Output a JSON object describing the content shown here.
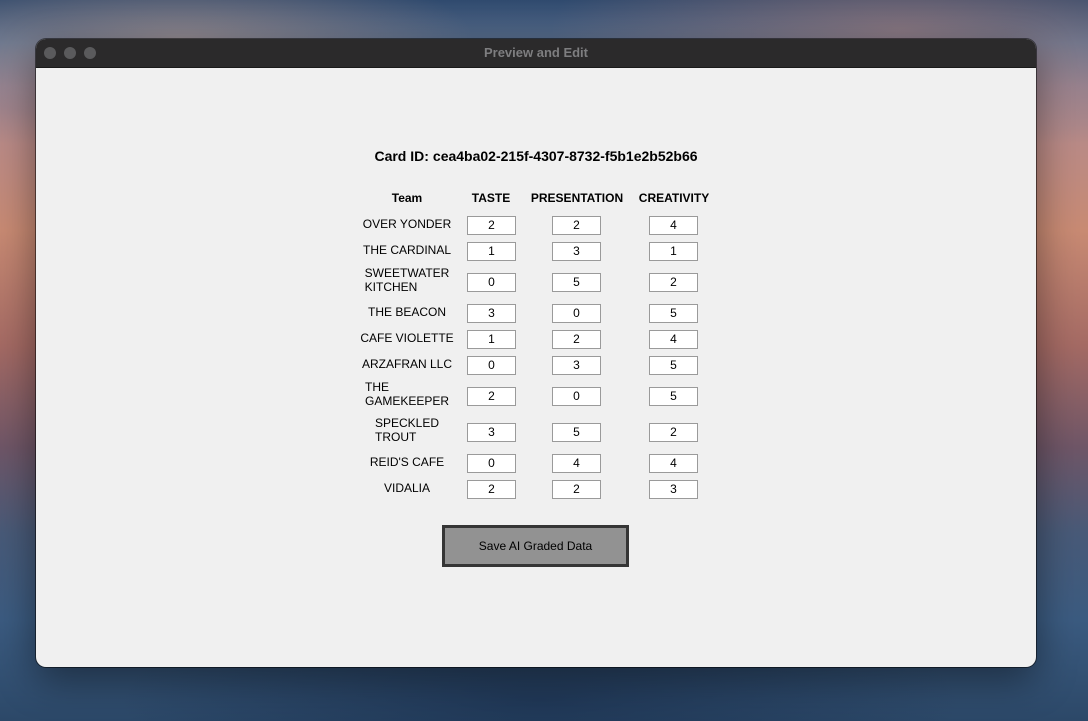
{
  "window": {
    "title": "Preview and Edit"
  },
  "card": {
    "label": "Card ID:",
    "id": "cea4ba02-215f-4307-8732-f5b1e2b52b66"
  },
  "columns": [
    "Team",
    "TASTE",
    "PRESENTATION",
    "CREATIVITY"
  ],
  "rows": [
    {
      "team": "OVER YONDER",
      "taste": "2",
      "presentation": "2",
      "creativity": "4"
    },
    {
      "team": "THE CARDINAL",
      "taste": "1",
      "presentation": "3",
      "creativity": "1"
    },
    {
      "team": "SWEETWATER\nKITCHEN",
      "taste": "0",
      "presentation": "5",
      "creativity": "2"
    },
    {
      "team": "THE BEACON",
      "taste": "3",
      "presentation": "0",
      "creativity": "5"
    },
    {
      "team": "CAFE VIOLETTE",
      "taste": "1",
      "presentation": "2",
      "creativity": "4"
    },
    {
      "team": "ARZAFRAN LLC",
      "taste": "0",
      "presentation": "3",
      "creativity": "5"
    },
    {
      "team": "THE\nGAMEKEEPER",
      "taste": "2",
      "presentation": "0",
      "creativity": "5"
    },
    {
      "team": "SPECKLED\nTROUT",
      "taste": "3",
      "presentation": "5",
      "creativity": "2"
    },
    {
      "team": "REID'S CAFE",
      "taste": "0",
      "presentation": "4",
      "creativity": "4"
    },
    {
      "team": "VIDALIA",
      "taste": "2",
      "presentation": "2",
      "creativity": "3"
    }
  ],
  "save_button": {
    "label": "Save AI Graded Data"
  }
}
